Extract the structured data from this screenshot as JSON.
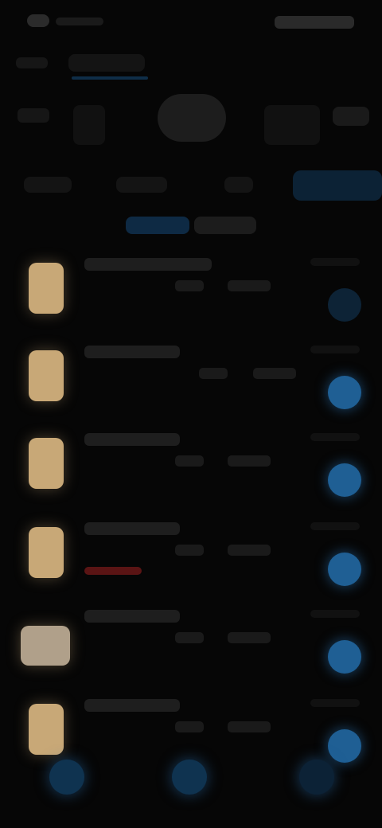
{
  "status_bar": {
    "time": "",
    "indicators": ""
  },
  "top_tabs": [
    {
      "label": ""
    },
    {
      "label": ""
    }
  ],
  "category_row": [
    {
      "label": ""
    },
    {
      "label": ""
    },
    {
      "label": ""
    },
    {
      "label": ""
    },
    {
      "label": ""
    }
  ],
  "filter_row": [
    {
      "label": ""
    },
    {
      "label": ""
    },
    {
      "label": ""
    },
    {
      "label": ""
    }
  ],
  "toggle_chips": [
    {
      "label": ""
    },
    {
      "label": ""
    }
  ],
  "list_items": [
    {
      "title": "",
      "meta1": "",
      "meta2": "",
      "icon": "book-thumbnail-icon"
    },
    {
      "title": "",
      "meta1": "",
      "meta2": "",
      "icon": "book-thumbnail-icon"
    },
    {
      "title": "",
      "meta1": "",
      "meta2": "",
      "icon": "book-thumbnail-icon"
    },
    {
      "title": "",
      "meta1": "",
      "meta2": "",
      "icon": "book-thumbnail-icon"
    },
    {
      "title": "",
      "meta1": "",
      "meta2": "",
      "icon": "image-thumbnail-icon"
    },
    {
      "title": "",
      "meta1": "",
      "meta2": "",
      "icon": "book-thumbnail-icon"
    }
  ],
  "bottom_nav": [
    {
      "icon": "nav-icon-1"
    },
    {
      "icon": "nav-icon-2"
    },
    {
      "icon": "nav-icon-3"
    }
  ],
  "colors": {
    "background": "#060606",
    "accent": "#2a74b8",
    "thumbnail": "#c8a877",
    "warning": "#5a1414"
  }
}
